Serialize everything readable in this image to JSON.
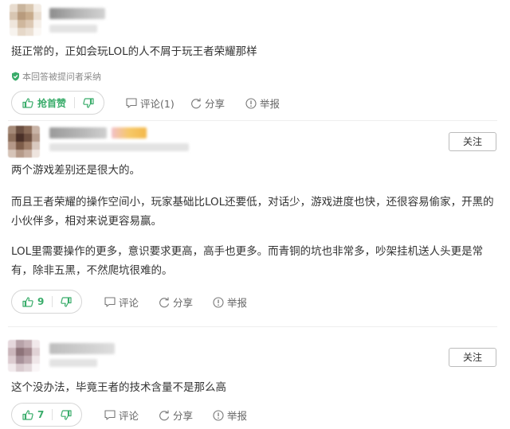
{
  "answers": [
    {
      "content": [
        "挺正常的，正如会玩LOL的人不屑于玩王者荣耀那样"
      ],
      "adopted_label": "本回答被提问者采纳",
      "vote_label": "抢首赞",
      "comment_label": "评论(1)",
      "share_label": "分享",
      "report_label": "举报"
    },
    {
      "follow_label": "关注",
      "content": [
        "两个游戏差别还是很大的。",
        "而且王者荣耀的操作空间小，玩家基础比LOL还要低，对话少，游戏进度也快，还很容易偷家，开黑的小伙伴多，相对来说更容易赢。",
        "LOL里需要操作的更多，意识要求更高，高手也更多。而青铜的坑也非常多，吵架挂机送人头更是常有，除非五黑，不然爬坑很难的。"
      ],
      "vote_count": "9",
      "comment_label": "评论",
      "share_label": "分享",
      "report_label": "举报"
    },
    {
      "follow_label": "关注",
      "content": [
        "这个没办法，毕竟王者的技术含量不是那么高"
      ],
      "vote_count": "7",
      "comment_label": "评论",
      "share_label": "分享",
      "report_label": "举报"
    }
  ],
  "colors": {
    "accent_green": "#39ac6a",
    "text": "#333333",
    "muted": "#666666"
  },
  "icons": [
    "thumb-up-icon",
    "thumb-down-icon",
    "comment-icon",
    "share-icon",
    "report-icon",
    "shield-check-icon"
  ]
}
